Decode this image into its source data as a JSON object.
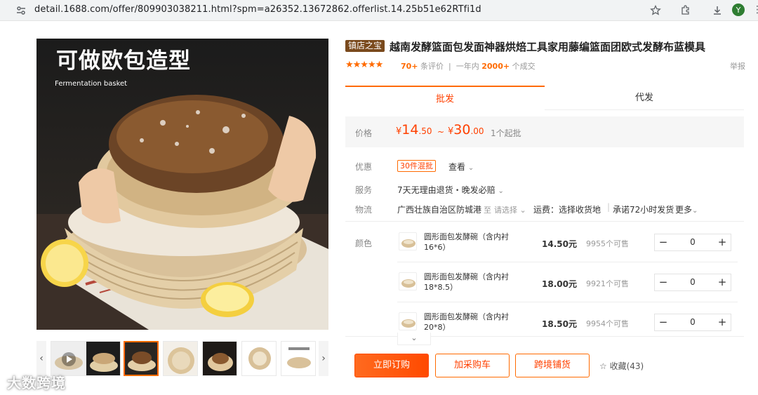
{
  "browser": {
    "url": "detail.1688.com/offer/809903038211.html?spm=a26352.13672862.offerlist.14.25b51e62RTfi1d",
    "avatar_letter": "Y"
  },
  "gallery": {
    "main_title": "可做欧包造型",
    "main_subtitle": "Fermentation basket",
    "thumb_count": 7,
    "active_thumb": 3
  },
  "watermark": "大数跨境",
  "product": {
    "badge": "镇店之宝",
    "title": "越南发酵篮面包发面神器烘焙工具家用藤编篮面团欧式发酵布蓝模具",
    "stars": "★★★★★",
    "review_count": "70+",
    "review_label": "条评价",
    "year_label": "一年内",
    "sold_count": "2000+",
    "sold_label": "个成交",
    "report": "举报"
  },
  "tabs": {
    "wholesale": "批发",
    "dropship": "代发"
  },
  "price": {
    "label": "价格",
    "currency": "¥",
    "low_int": "14",
    "low_dec": ".50",
    "tilde": "~",
    "high_int": "30",
    "high_dec": ".00",
    "min_order": "1个起批"
  },
  "discount": {
    "label": "优惠",
    "tag": "30件混批",
    "view": "查看"
  },
  "service": {
    "label": "服务",
    "text": "7天无理由退货・晚发必赔"
  },
  "logistics": {
    "label": "物流",
    "from": "广西壮族自治区防城港",
    "to": "至",
    "select": "请选择",
    "freight": "运费：选择收货地",
    "promise": "承诺72小时发货",
    "more": "更多"
  },
  "color": {
    "label": "颜色",
    "skus": [
      {
        "name": "圆形面包发酵碗（含内衬16*6）",
        "price": "14.50元",
        "stock": "9955个可售",
        "qty": "0"
      },
      {
        "name": "圆形面包发酵碗（含内衬18*8.5）",
        "price": "18.00元",
        "stock": "9921个可售",
        "qty": "0"
      },
      {
        "name": "圆形面包发酵碗（含内衬20*8）",
        "price": "18.50元",
        "stock": "9954个可售",
        "qty": "0"
      }
    ]
  },
  "actions": {
    "buy": "立即订购",
    "cart": "加采购车",
    "shop": "跨境铺货",
    "fav": "收藏(43)"
  },
  "colors": {
    "accent": "#ff6a00",
    "price": "#ff4000",
    "badge": "#7a4a1d"
  }
}
